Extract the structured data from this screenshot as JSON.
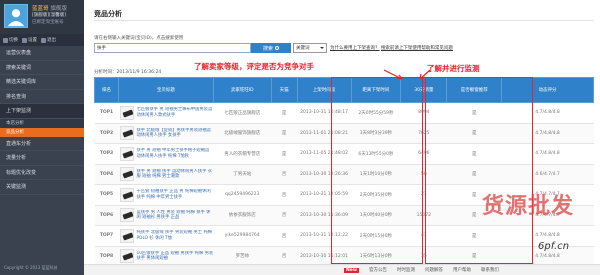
{
  "user": {
    "name": "蓝蓝哥",
    "version": "旗舰版",
    "level": "[旗舰版][温馨版]",
    "status": "已绑定淘宝账号"
  },
  "sidebar": {
    "tools": [
      {
        "label": "切换",
        "icon": "switch-icon"
      },
      {
        "label": "设置",
        "icon": "gear-icon"
      },
      {
        "label": "退出",
        "icon": "logout-icon"
      }
    ],
    "items": [
      {
        "label": "运营仪表盘"
      },
      {
        "label": "搜索关键词"
      },
      {
        "label": "精选关键词库"
      },
      {
        "label": "排名查询"
      },
      {
        "label": "上下架监测"
      }
    ],
    "subitems": [
      {
        "label": "本店分析"
      },
      {
        "label": "竞品分析",
        "selected": true
      }
    ],
    "items_after": [
      {
        "label": "直通车分析"
      },
      {
        "label": "流量分析"
      },
      {
        "label": "标题优化改变"
      },
      {
        "label": "关键监测"
      }
    ],
    "footer": "Copyright © 2013 蓝蓝科技"
  },
  "page": {
    "title": "竞品分析",
    "search_hint": "请在右侧输入关键词(宝贝ID)，点击搜索使用",
    "search_value": "扶手",
    "search_button": "搜索",
    "mode_select": "关键词",
    "help_link_1": "为什么要用上下架查询？",
    "help_link_2": "搜索前请上下架使用帮助和常见问题",
    "analysis_time": "分析时间：2013/11/9 16:36:24"
  },
  "annotations": {
    "left": "了解卖家等级，评定是否为竞争对手",
    "right": "了解并进行监测"
  },
  "table": {
    "headers": [
      "排名",
      "宝贝标题",
      "卖家旺旺ID",
      "天猫",
      "上架时间段",
      "距离下架时间",
      "30天销量",
      "是否橱窗推荐",
      "动态评分"
    ],
    "rows": [
      {
        "rank": "TOP1",
        "title": "七匹狼扶手 男 短袖男士棉布中国男装运动休闲男人款式扶手",
        "seller": "七匹狼正品旗舰店",
        "tmall": "是",
        "listed": "2013-10-31 10:48:17",
        "remaining": "2天0时55分59秒",
        "sales": "8994",
        "showcase": "是",
        "score": "4.7/4.8/4.8"
      },
      {
        "rank": "TOP2",
        "title": "扶手 北极绒【促销】男扶手男装短袖运动休闲男人扶手 女扶手",
        "seller": "北极绒服饰旗舰店",
        "tmall": "是",
        "listed": "2013-11-01 21:08:21",
        "remaining": "3天8时3分39秒",
        "sales": "7625",
        "showcase": "是",
        "score": "4.7/4.8/4.8"
      },
      {
        "rank": "TOP3",
        "title": "扶手 男 短袖 中年男士扶手格子短袖运动休闲男人扶手 纯棉 T恤秋",
        "seller": "男人的衣帽专营店",
        "tmall": "是",
        "listed": "2013-11-05 21:48:02",
        "remaining": "6天13时55分0秒",
        "sales": "6496",
        "showcase": "是",
        "score": "4.7/4.8/4.8"
      },
      {
        "rank": "TOP4",
        "title": "扶手 男 短袖 扶手 运动休闲男人扶手 衣服 短袖 纯棉 男士潮款",
        "seller": "丁男天站",
        "tmall": "否",
        "listed": "2013-10-30 12:26:36",
        "remaining": "1天1时10分0秒",
        "sales": "56",
        "showcase": "是",
        "score": "4.6/4.7/4.7"
      },
      {
        "rank": "TOP5",
        "title": "十匹狼 短袖扶手 正品 男 纯棉短袖休闲扶手 纯棉 中年男士扶手",
        "seller": "qq2459496223",
        "tmall": "否",
        "listed": "2013-10-31 12:05:59",
        "remaining": "2天0时35分0秒",
        "sales": "21",
        "showcase": "是",
        "score": "4.7/4.7/4.7"
      },
      {
        "rank": "TOP6",
        "title": "蓝扶手 男 人性 男装 短袖 纯棉 扶手 休闲 短袖衫 男扶手 正品",
        "seller": "依依衣服饰店",
        "tmall": "否",
        "listed": "2013-10-30 11:36:09",
        "remaining": "1天0时40分0秒",
        "sales": "15072",
        "showcase": "是",
        "score": "4.7/4.7/4.7"
      },
      {
        "rank": "TOP7",
        "title": "纯扶手 北极绒 扶手 男装短袖 男士 纯棉 POLO 衫 休闲 T恤",
        "seller": "yike529984764",
        "tmall": "否",
        "listed": "2013-10-31 12:12:22",
        "remaining": "2天0时15分0秒",
        "sales": "41",
        "showcase": "是",
        "score": "4.7/4.8/4.8"
      },
      {
        "rank": "TOP8",
        "title": "10匹狼扶手 正品 短袖 男扶手 纯棉 男装 扶手 男休闲短袖",
        "seller": "罗苦帅",
        "tmall": "否",
        "listed": "2013-10-30 16:12:01",
        "remaining": "1天6时13分0秒",
        "sales": "35",
        "showcase": "是",
        "score": "4.7/4.8/4.8"
      }
    ]
  },
  "footer": {
    "news_tag": "New",
    "links": [
      "官方公告",
      "时时监测",
      "问题解答",
      "用户帮助",
      "联系我们"
    ]
  },
  "watermark": {
    "text": "货源批发",
    "url": "6pf.cn"
  }
}
